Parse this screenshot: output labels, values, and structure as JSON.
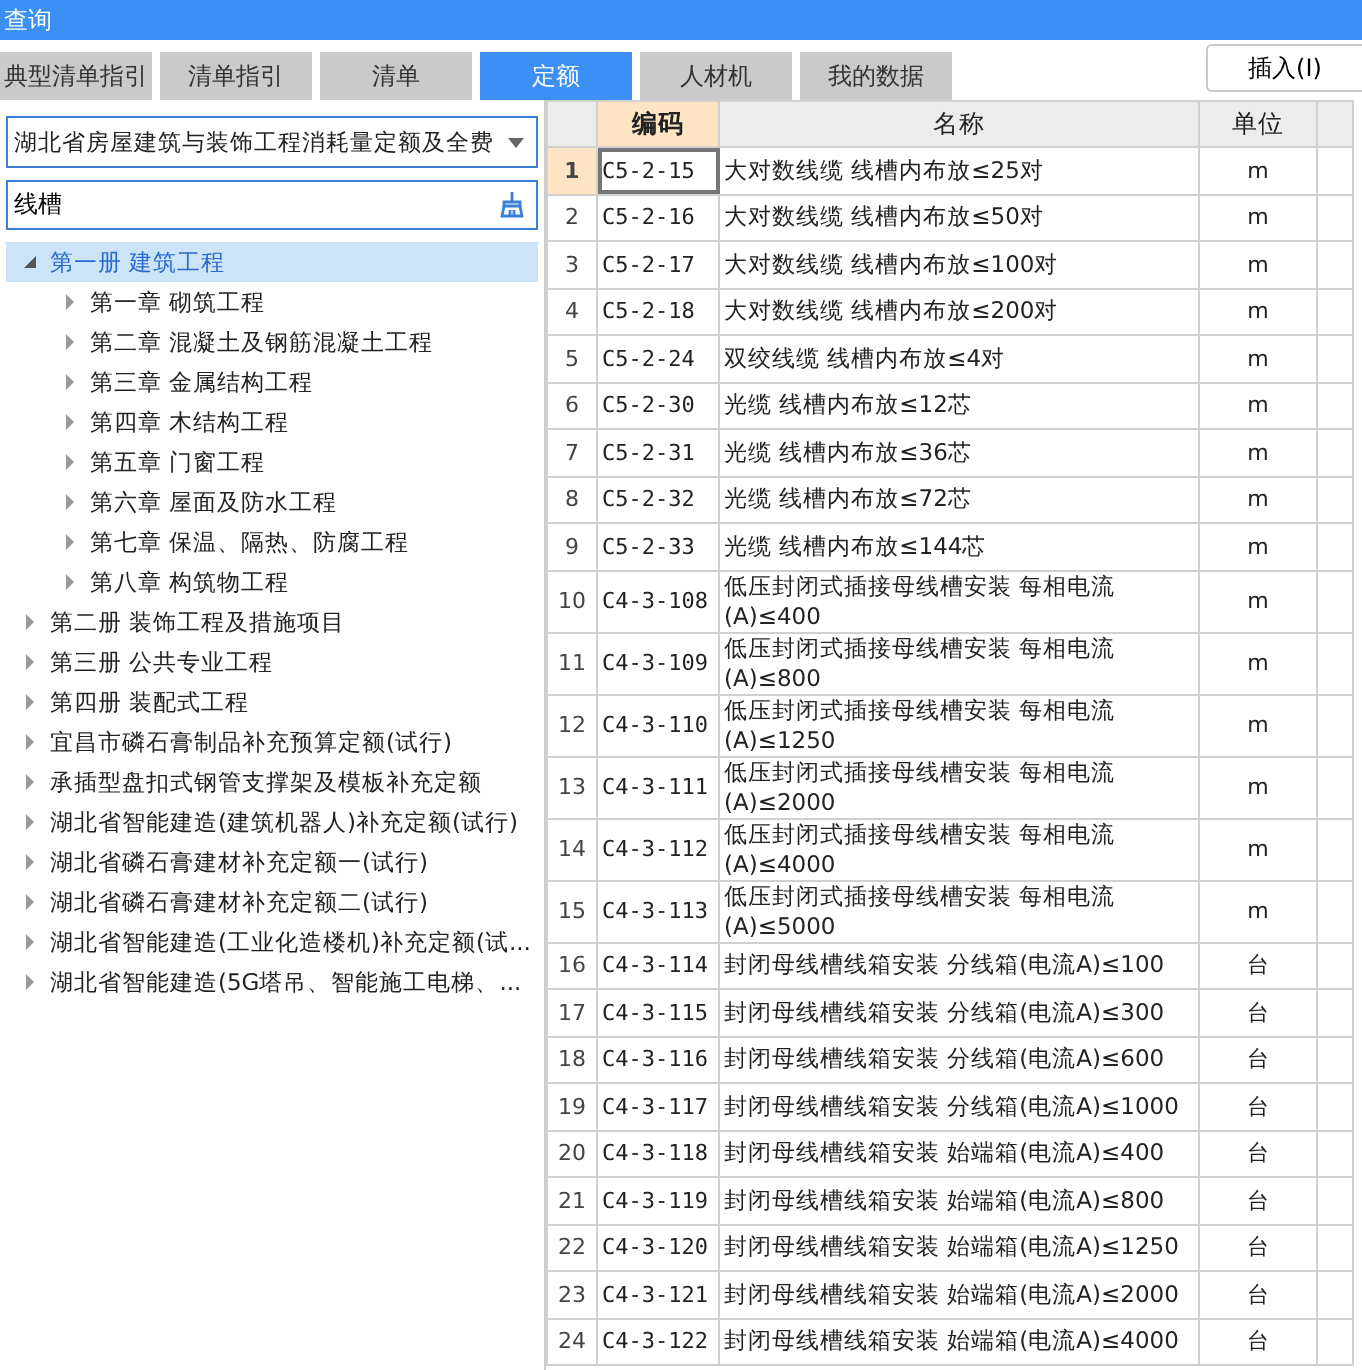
{
  "window": {
    "title": "查询"
  },
  "tabs": [
    {
      "label": "典型清单指引",
      "selected": false
    },
    {
      "label": "清单指引",
      "selected": false
    },
    {
      "label": "清单",
      "selected": false
    },
    {
      "label": "定额",
      "selected": true
    },
    {
      "label": "人材机",
      "selected": false
    },
    {
      "label": "我的数据",
      "selected": false
    }
  ],
  "insert_button": "插入(I)",
  "library_dropdown": {
    "value": "湖北省房屋建筑与装饰工程消耗量定额及全费"
  },
  "search": {
    "value": "线槽"
  },
  "tree": [
    {
      "label": "第一册 建筑工程",
      "expanded": true,
      "selected": true,
      "children": [
        {
          "label": "第一章 砌筑工程",
          "expanded": false,
          "selected": false
        },
        {
          "label": "第二章 混凝土及钢筋混凝土工程",
          "expanded": false,
          "selected": false
        },
        {
          "label": "第三章 金属结构工程",
          "expanded": false,
          "selected": false
        },
        {
          "label": "第四章 木结构工程",
          "expanded": false,
          "selected": false
        },
        {
          "label": "第五章 门窗工程",
          "expanded": false,
          "selected": false
        },
        {
          "label": "第六章 屋面及防水工程",
          "expanded": false,
          "selected": false
        },
        {
          "label": "第七章 保温、隔热、防腐工程",
          "expanded": false,
          "selected": false
        },
        {
          "label": "第八章 构筑物工程",
          "expanded": false,
          "selected": false
        }
      ]
    },
    {
      "label": "第二册 装饰工程及措施项目",
      "expanded": false,
      "selected": false
    },
    {
      "label": "第三册 公共专业工程",
      "expanded": false,
      "selected": false
    },
    {
      "label": "第四册 装配式工程",
      "expanded": false,
      "selected": false
    },
    {
      "label": "宜昌市磷石膏制品补充预算定额(试行)",
      "expanded": false,
      "selected": false
    },
    {
      "label": "承插型盘扣式钢管支撑架及模板补充定额",
      "expanded": false,
      "selected": false
    },
    {
      "label": "湖北省智能建造(建筑机器人)补充定额(试行)",
      "expanded": false,
      "selected": false
    },
    {
      "label": "湖北省磷石膏建材补充定额一(试行)",
      "expanded": false,
      "selected": false
    },
    {
      "label": "湖北省磷石膏建材补充定额二(试行)",
      "expanded": false,
      "selected": false
    },
    {
      "label": "湖北省智能建造(工业化造楼机)补充定额(试...",
      "expanded": false,
      "selected": false
    },
    {
      "label": "湖北省智能建造(5G塔吊、智能施工电梯、...",
      "expanded": false,
      "selected": false
    }
  ],
  "table": {
    "columns": [
      {
        "label": "编码",
        "selected": true
      },
      {
        "label": "名称",
        "selected": false
      },
      {
        "label": "单位",
        "selected": false
      }
    ],
    "rows": [
      {
        "num": "1",
        "code": "C5-2-15",
        "name": "大对数线缆 线槽内布放≤25对",
        "unit": "m",
        "selected": true
      },
      {
        "num": "2",
        "code": "C5-2-16",
        "name": "大对数线缆 线槽内布放≤50对",
        "unit": "m",
        "selected": false
      },
      {
        "num": "3",
        "code": "C5-2-17",
        "name": "大对数线缆 线槽内布放≤100对",
        "unit": "m",
        "selected": false
      },
      {
        "num": "4",
        "code": "C5-2-18",
        "name": "大对数线缆 线槽内布放≤200对",
        "unit": "m",
        "selected": false
      },
      {
        "num": "5",
        "code": "C5-2-24",
        "name": "双绞线缆 线槽内布放≤4对",
        "unit": "m",
        "selected": false
      },
      {
        "num": "6",
        "code": "C5-2-30",
        "name": "光缆 线槽内布放≤12芯",
        "unit": "m",
        "selected": false
      },
      {
        "num": "7",
        "code": "C5-2-31",
        "name": "光缆 线槽内布放≤36芯",
        "unit": "m",
        "selected": false
      },
      {
        "num": "8",
        "code": "C5-2-32",
        "name": "光缆 线槽内布放≤72芯",
        "unit": "m",
        "selected": false
      },
      {
        "num": "9",
        "code": "C5-2-33",
        "name": "光缆 线槽内布放≤144芯",
        "unit": "m",
        "selected": false
      },
      {
        "num": "10",
        "code": "C4-3-108",
        "name": "低压封闭式插接母线槽安装 每相电流\n(A)≤400",
        "unit": "m",
        "selected": false
      },
      {
        "num": "11",
        "code": "C4-3-109",
        "name": "低压封闭式插接母线槽安装 每相电流\n(A)≤800",
        "unit": "m",
        "selected": false
      },
      {
        "num": "12",
        "code": "C4-3-110",
        "name": "低压封闭式插接母线槽安装 每相电流\n(A)≤1250",
        "unit": "m",
        "selected": false
      },
      {
        "num": "13",
        "code": "C4-3-111",
        "name": "低压封闭式插接母线槽安装 每相电流\n(A)≤2000",
        "unit": "m",
        "selected": false
      },
      {
        "num": "14",
        "code": "C4-3-112",
        "name": "低压封闭式插接母线槽安装 每相电流\n(A)≤4000",
        "unit": "m",
        "selected": false
      },
      {
        "num": "15",
        "code": "C4-3-113",
        "name": "低压封闭式插接母线槽安装 每相电流\n(A)≤5000",
        "unit": "m",
        "selected": false
      },
      {
        "num": "16",
        "code": "C4-3-114",
        "name": "封闭母线槽线箱安装 分线箱(电流A)≤100",
        "unit": "台",
        "selected": false
      },
      {
        "num": "17",
        "code": "C4-3-115",
        "name": "封闭母线槽线箱安装 分线箱(电流A)≤300",
        "unit": "台",
        "selected": false
      },
      {
        "num": "18",
        "code": "C4-3-116",
        "name": "封闭母线槽线箱安装 分线箱(电流A)≤600",
        "unit": "台",
        "selected": false
      },
      {
        "num": "19",
        "code": "C4-3-117",
        "name": "封闭母线槽线箱安装 分线箱(电流A)≤1000",
        "unit": "台",
        "selected": false
      },
      {
        "num": "20",
        "code": "C4-3-118",
        "name": "封闭母线槽线箱安装 始端箱(电流A)≤400",
        "unit": "台",
        "selected": false
      },
      {
        "num": "21",
        "code": "C4-3-119",
        "name": "封闭母线槽线箱安装 始端箱(电流A)≤800",
        "unit": "台",
        "selected": false
      },
      {
        "num": "22",
        "code": "C4-3-120",
        "name": "封闭母线槽线箱安装 始端箱(电流A)≤1250",
        "unit": "台",
        "selected": false
      },
      {
        "num": "23",
        "code": "C4-3-121",
        "name": "封闭母线槽线箱安装 始端箱(电流A)≤2000",
        "unit": "台",
        "selected": false
      },
      {
        "num": "24",
        "code": "C4-3-122",
        "name": "封闭母线槽线箱安装 始端箱(电流A)≤4000",
        "unit": "台",
        "selected": false
      }
    ]
  }
}
